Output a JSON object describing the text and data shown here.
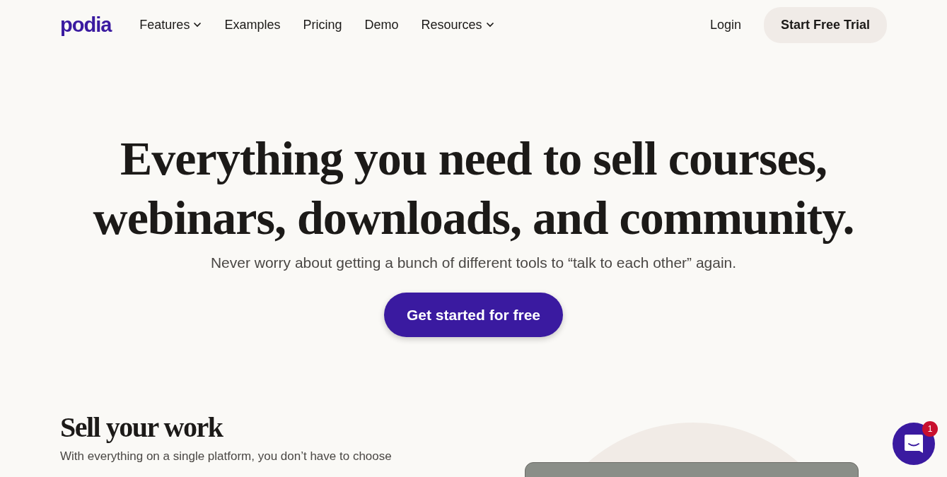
{
  "logo": "podia",
  "nav": [
    {
      "label": "Features",
      "dropdown": true
    },
    {
      "label": "Examples",
      "dropdown": false
    },
    {
      "label": "Pricing",
      "dropdown": false
    },
    {
      "label": "Demo",
      "dropdown": false
    },
    {
      "label": "Resources",
      "dropdown": true
    }
  ],
  "login": "Login",
  "trial_button": "Start Free Trial",
  "hero": {
    "title": "Everything you need to sell courses, webinars, downloads, and community.",
    "subtitle": "Never worry about getting a bunch of different tools to “talk to each other” again.",
    "cta": "Get started for free"
  },
  "section": {
    "title": "Sell your work",
    "text": "With everything on a single platform, you don’t have to choose"
  },
  "chat": {
    "badge": "1"
  }
}
